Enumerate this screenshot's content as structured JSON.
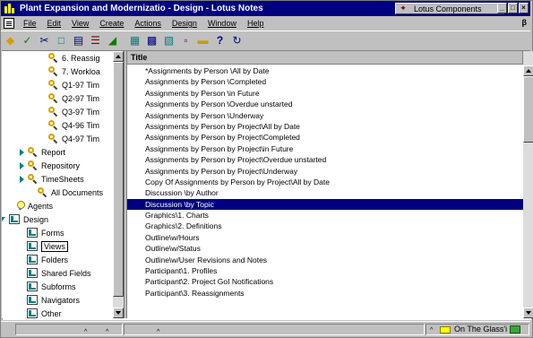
{
  "window": {
    "title": "Plant Expansion and Modernizatio - Design - Lotus Notes",
    "components_label": "Lotus Components",
    "controls": [
      "_",
      "□",
      "×"
    ]
  },
  "menu": {
    "items": [
      "File",
      "Edit",
      "View",
      "Create",
      "Actions",
      "Design",
      "Window",
      "Help"
    ],
    "right_glyph": "β"
  },
  "toolbar": {
    "icons": [
      "diamond-icon",
      "smarticon-icon",
      "cut-icon",
      "copy-icon",
      "paste-icon",
      "edit-icon",
      "navigator-icon",
      "design-form-icon",
      "design-view-icon",
      "design-folder-icon",
      "properties-icon",
      "open-folder-icon",
      "help-icon",
      "refresh-icon"
    ]
  },
  "navigator": {
    "items": [
      {
        "label": "6. Reassig",
        "indent": 4,
        "icon": "magnifier",
        "twisty": ""
      },
      {
        "label": "7. Workloa",
        "indent": 4,
        "icon": "magnifier",
        "twisty": ""
      },
      {
        "label": "Q1-97 Tim",
        "indent": 4,
        "icon": "magnifier",
        "twisty": ""
      },
      {
        "label": "Q2-97 Tim",
        "indent": 4,
        "icon": "magnifier",
        "twisty": ""
      },
      {
        "label": "Q3-97 Tim",
        "indent": 4,
        "icon": "magnifier",
        "twisty": ""
      },
      {
        "label": "Q4-96 Tim",
        "indent": 4,
        "icon": "magnifier",
        "twisty": ""
      },
      {
        "label": "Q4-97 Tim",
        "indent": 4,
        "icon": "magnifier",
        "twisty": ""
      },
      {
        "label": "Report",
        "indent": 2,
        "icon": "magnifier",
        "twisty": "right"
      },
      {
        "label": "Repository",
        "indent": 2,
        "icon": "magnifier",
        "twisty": "right"
      },
      {
        "label": "TimeSheets",
        "indent": 2,
        "icon": "magnifier",
        "twisty": "right"
      },
      {
        "label": "All Documents",
        "indent": 3,
        "icon": "magnifier",
        "twisty": ""
      },
      {
        "label": "Agents",
        "indent": 1,
        "icon": "bulb",
        "twisty": ""
      },
      {
        "label": "Design",
        "indent": 0,
        "icon": "design",
        "twisty": "down"
      },
      {
        "label": "Forms",
        "indent": 2,
        "icon": "design",
        "twisty": ""
      },
      {
        "label": "Views",
        "indent": 2,
        "icon": "design",
        "twisty": "",
        "boxed": true
      },
      {
        "label": "Folders",
        "indent": 2,
        "icon": "design",
        "twisty": ""
      },
      {
        "label": "Shared Fields",
        "indent": 2,
        "icon": "design",
        "twisty": ""
      },
      {
        "label": "Subforms",
        "indent": 2,
        "icon": "design",
        "twisty": ""
      },
      {
        "label": "Navigators",
        "indent": 2,
        "icon": "design",
        "twisty": ""
      },
      {
        "label": "Other",
        "indent": 2,
        "icon": "design",
        "twisty": ""
      }
    ]
  },
  "view": {
    "column_title": "Title",
    "selected_index": 12,
    "rows": [
      "*Assignments by Person  \\All by Date",
      "Assignments by Person  \\Completed",
      "Assignments by Person  \\in Future",
      "Assignments by Person  \\Overdue unstarted",
      "Assignments by Person  \\Underway",
      "Assignments by Person by Project\\All by Date",
      "Assignments by Person by Project\\Completed",
      "Assignments by Person by Project\\in Future",
      "Assignments by Person by Project\\Overdue unstarted",
      "Assignments by Person by Project\\Underway",
      "Copy Of Assignments by Person by Project\\All by Date",
      "Discussion \\by Author",
      "Discussion \\by Topic",
      "Graphics\\1. Charts",
      "Graphics\\2. Definitions",
      "Outline\\w/Hours",
      "Outline\\w/Status",
      "Outline\\w/User Revisions and Notes",
      "Participant\\1. Profiles",
      "Participant\\2. Project GoI Notifications",
      "Participant\\3. Reassignments"
    ]
  },
  "status": {
    "cells": [
      "^",
      "^",
      "^"
    ],
    "right_caret": "^",
    "location": "On The Glass'i"
  }
}
